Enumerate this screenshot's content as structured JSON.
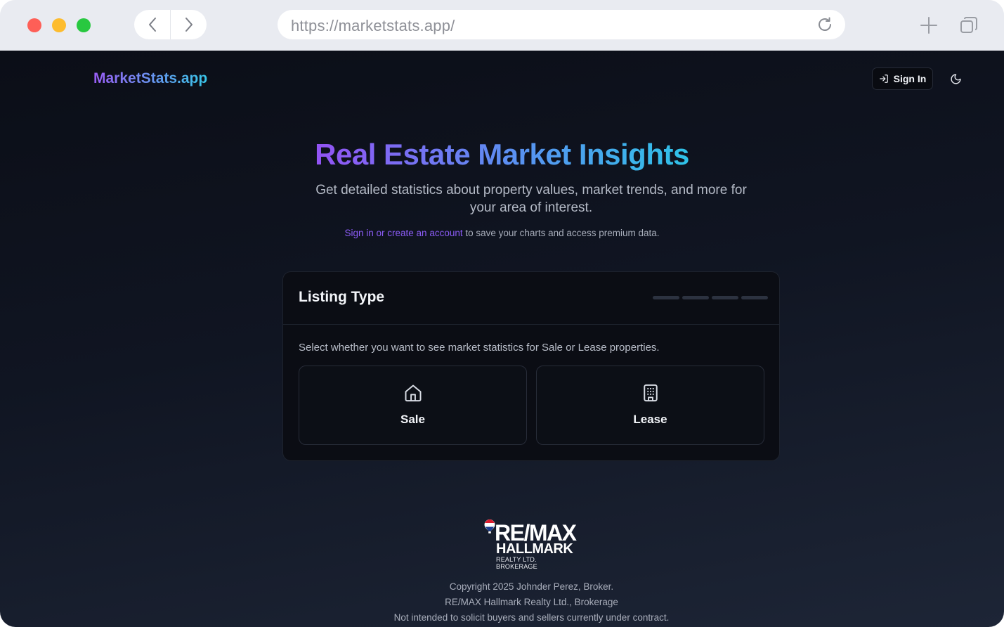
{
  "browser": {
    "url": "https://marketstats.app/"
  },
  "header": {
    "brand": "MarketStats.app",
    "sign_in_label": "Sign In"
  },
  "hero": {
    "title": "Real Estate Market Insights",
    "subtitle": "Get detailed statistics about property values, market trends, and more for your area of interest.",
    "note_link": "Sign in or create an account",
    "note_text": " to save your charts and access premium data."
  },
  "card": {
    "title": "Listing Type",
    "description": "Select whether you want to see market statistics for Sale or Lease properties.",
    "options": [
      {
        "label": "Sale",
        "icon": "home-icon"
      },
      {
        "label": "Lease",
        "icon": "building-icon"
      }
    ],
    "step_count": 4
  },
  "footer": {
    "logo": {
      "remax": "RE/MAX",
      "hallmark": "HALLMARK",
      "brokerage": "REALTY LTD. BROKERAGE"
    },
    "lines": [
      "Copyright 2025 Johnder Perez, Broker.",
      "RE/MAX Hallmark Realty Ltd., Brokerage",
      "Not intended to solicit buyers and sellers currently under contract."
    ]
  },
  "colors": {
    "accent_purple": "#8b5cf6",
    "accent_cyan": "#2fc3e8",
    "background": "#101522"
  }
}
